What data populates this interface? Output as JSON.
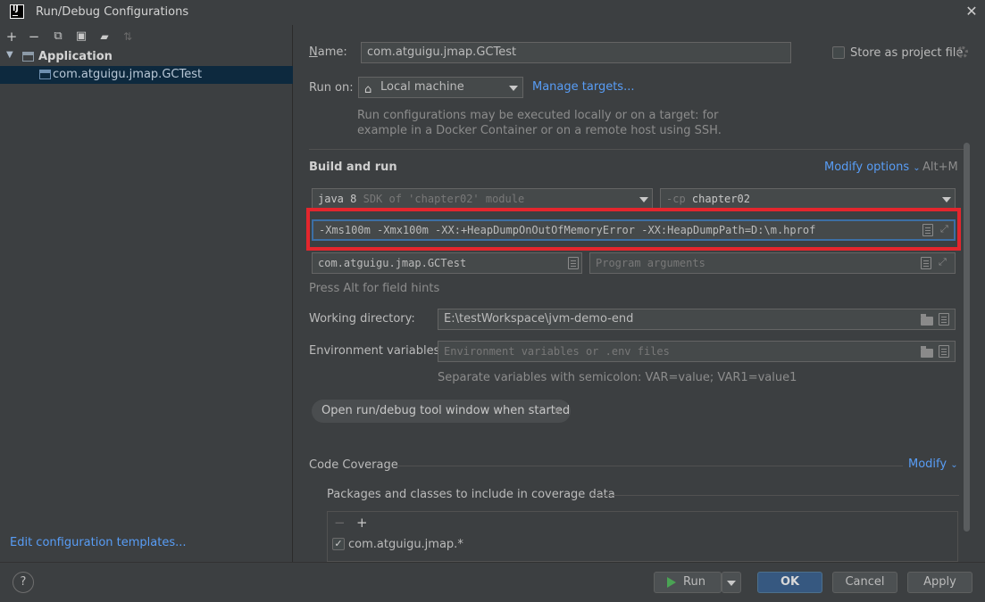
{
  "window": {
    "title": "Run/Debug Configurations",
    "app_icon_text": "IJ",
    "close_glyph": "✕"
  },
  "left_toolbar": {
    "add": "+",
    "remove": "−",
    "copy": "⧉",
    "save": "▣",
    "folder": "▰",
    "sort": "⇅"
  },
  "tree": {
    "group_label": "Application",
    "selected_item": "com.atguigu.jmap.GCTest"
  },
  "edit_templates_link": "Edit configuration templates...",
  "form": {
    "name_label": "Name:",
    "name_value": "com.atguigu.jmap.GCTest",
    "store_label": "Store as project file",
    "store_checked": false,
    "run_on_label": "Run on:",
    "run_on_value": "Local machine",
    "manage_targets": "Manage targets...",
    "run_on_hint_line1": "Run configurations may be executed locally or on a target: for",
    "run_on_hint_line2": "example in a Docker Container or on a remote host using SSH.",
    "build_and_run": "Build and run",
    "modify_options": "Modify options",
    "modify_shortcut": "Alt+M",
    "sdk_prefix": "java 8",
    "sdk_suffix": "SDK of 'chapter02' module",
    "cp_prefix": "-cp",
    "cp_value": "chapter02",
    "vm_options": "-Xms100m -Xmx100m -XX:+HeapDumpOnOutOfMemoryError -XX:HeapDumpPath=D:\\m.hprof",
    "main_class": "com.atguigu.jmap.GCTest",
    "program_args_placeholder": "Program arguments",
    "field_hint": "Press Alt for field hints",
    "working_dir_label": "Working directory:",
    "working_dir_value": "E:\\testWorkspace\\jvm-demo-end",
    "env_label": "Environment variables:",
    "env_placeholder": "Environment variables or .env files",
    "env_hint": "Separate variables with semicolon: VAR=value; VAR1=value1",
    "open_tool_window_chip": "Open run/debug tool window when started",
    "code_coverage": "Code Coverage",
    "modify": "Modify",
    "coverage_packages_label": "Packages and classes to include in coverage data",
    "coverage_item": "com.atguigu.jmap.*"
  },
  "buttons": {
    "help": "?",
    "run": "Run",
    "ok": "OK",
    "cancel": "Cancel",
    "apply": "Apply"
  },
  "colors": {
    "accent_link": "#589df6",
    "highlight_box": "#e3262d",
    "selection": "#0d293e",
    "primary_button": "#365880"
  }
}
